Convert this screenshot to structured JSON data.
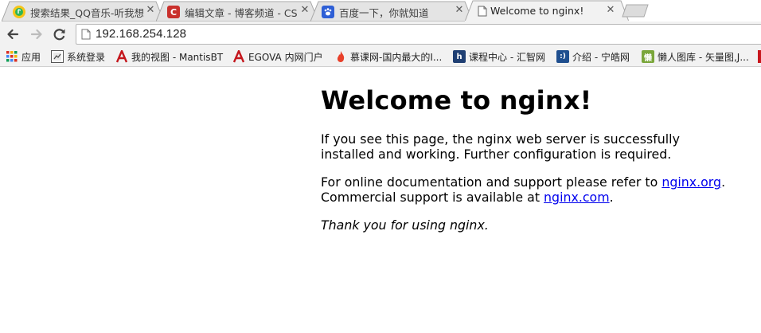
{
  "tabs": [
    {
      "title": "搜索结果_QQ音乐-听我想",
      "favicon": "qq-music-icon",
      "active": false
    },
    {
      "title": "编辑文章 - 博客频道 - CS",
      "favicon": "csdn-icon",
      "active": false
    },
    {
      "title": "百度一下，你就知道",
      "favicon": "baidu-paw-icon",
      "active": false
    },
    {
      "title": "Welcome to nginx!",
      "favicon": "page-icon",
      "active": true
    }
  ],
  "toolbar": {
    "url": "192.168.254.128"
  },
  "bookmarks": [
    {
      "label": "应用",
      "icon": "apps-grid-icon"
    },
    {
      "label": "系统登录",
      "icon": "login-page-icon"
    },
    {
      "label": "我的视图 - MantisBT",
      "icon": "mantis-icon"
    },
    {
      "label": "EGOVA 内网门户",
      "icon": "egova-icon"
    },
    {
      "label": "慕课网-国内最大的I...",
      "icon": "flame-icon"
    },
    {
      "label": "课程中心 - 汇智网",
      "icon": "hubwiz-icon"
    },
    {
      "label": "介绍 - 宁皓网",
      "icon": "ninghao-icon"
    },
    {
      "label": "懒人图库 - 矢量图,J...",
      "icon": "lanren-icon"
    }
  ],
  "page": {
    "heading": "Welcome to nginx!",
    "p1": "If you see this page, the nginx web server is successfully installed and working. Further configuration is required.",
    "p2_before": "For online documentation and support please refer to ",
    "p2_link1": "nginx.org",
    "p2_mid": ".",
    "p2_line2": "Commercial support is available at ",
    "p2_link2": "nginx.com",
    "p2_end": ".",
    "p3": "Thank you for using nginx."
  },
  "colors": {
    "link": "#0000ee",
    "chrome_bg": "#f2f2f2",
    "tab_inactive": "#e4e4e4"
  }
}
